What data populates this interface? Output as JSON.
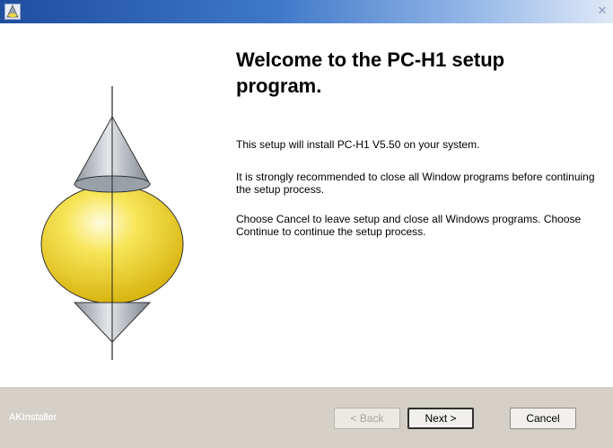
{
  "window": {
    "title": ""
  },
  "welcome": {
    "heading": "Welcome to the PC-H1 setup program.",
    "paragraphs": [
      "This setup will install PC-H1 V5.50 on your system.",
      "It is strongly recommended to close all Window programs before continuing the setup process.",
      "Choose Cancel to leave setup and close all Windows programs. Choose Continue to continue the setup process."
    ]
  },
  "footer": {
    "brand": "AKInstaller",
    "buttons": {
      "back": "< Back",
      "next": "Next >",
      "cancel": "Cancel"
    },
    "back_enabled": false
  },
  "icons": {
    "app": "installer-app-icon",
    "close": "close-icon",
    "art": "spinning-top-illustration"
  },
  "colors": {
    "titlebar_start": "#1f4e9e",
    "footer_bg": "#d4d0c8",
    "sphere": "#f5e04a"
  }
}
